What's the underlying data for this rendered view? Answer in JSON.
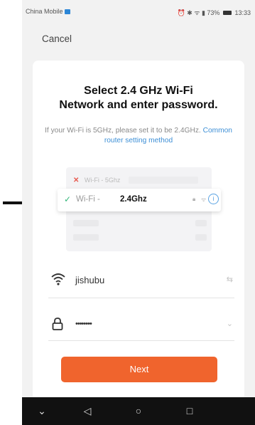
{
  "status_bar": {
    "carrier": "China Mobile",
    "battery": "73%",
    "time": "13:33"
  },
  "header": {
    "cancel_label": "Cancel"
  },
  "card": {
    "title_line1": "Select 2.4 GHz Wi-Fi",
    "title_line2": "Network and enter password.",
    "subtitle_text": "If your Wi-Fi is 5GHz, please set it to be 2.4GHz.",
    "subtitle_link": "Common router setting method"
  },
  "illustration": {
    "wifi_5g_prefix": "Wi-Fi -",
    "wifi_5g_band": "5Ghz",
    "wifi_24_prefix": "Wi-Fi -",
    "wifi_24_band": "2.4Ghz"
  },
  "form": {
    "ssid_value": "jishubu",
    "password_value": "••••••••"
  },
  "actions": {
    "next_label": "Next"
  },
  "icons": {
    "wifi": "wifi-icon",
    "lock": "lock-icon",
    "switch": "switch-network-icon",
    "eye": "show-password-icon",
    "back": "back-triangle-icon",
    "home": "home-circle-icon",
    "recent": "recent-square-icon"
  },
  "colors": {
    "accent": "#f0642d",
    "link": "#3d8fd6",
    "check": "#34b77a",
    "error": "#e75a4f"
  }
}
